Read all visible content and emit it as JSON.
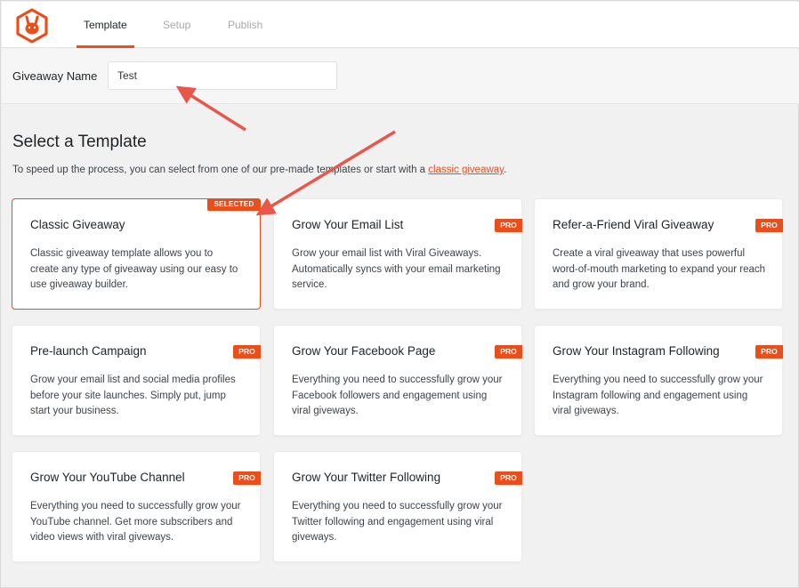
{
  "brand": {
    "accent": "#e94e1b",
    "logo": "rabbit-logo-icon"
  },
  "tabs": [
    {
      "label": "Template",
      "active": true
    },
    {
      "label": "Setup",
      "active": false
    },
    {
      "label": "Publish",
      "active": false
    }
  ],
  "giveaway_name": {
    "label": "Giveaway Name",
    "value": "Test"
  },
  "section": {
    "title": "Select a Template",
    "subtitle_prefix": "To speed up the process, you can select from one of our pre-made templates or start with a",
    "subtitle_link": "classic giveaway",
    "subtitle_suffix": "."
  },
  "templates": [
    {
      "title": "Classic Giveaway",
      "desc": "Classic giveaway template allows you to create any type of giveaway using our easy to use giveaway builder.",
      "badge": "SELECTED"
    },
    {
      "title": "Grow Your Email List",
      "desc": "Grow your email list with Viral Giveaways. Automatically syncs with your email marketing service.",
      "badge": "PRO"
    },
    {
      "title": "Refer-a-Friend Viral Giveaway",
      "desc": "Create a viral giveaway that uses powerful word-of-mouth marketing to expand your reach and grow your brand.",
      "badge": "PRO"
    },
    {
      "title": "Pre-launch Campaign",
      "desc": "Grow your email list and social media profiles before your site launches. Simply put, jump start your business.",
      "badge": "PRO"
    },
    {
      "title": "Grow Your Facebook Page",
      "desc": "Everything you need to successfully grow your Facebook followers and engagement using viral giveways.",
      "badge": "PRO"
    },
    {
      "title": "Grow Your Instagram Following",
      "desc": "Everything you need to successfully grow your Instagram following and engagement using viral giveways.",
      "badge": "PRO"
    },
    {
      "title": "Grow Your YouTube Channel",
      "desc": "Everything you need to successfully grow your YouTube channel. Get more subscribers and video views with viral giveways.",
      "badge": "PRO"
    },
    {
      "title": "Grow Your Twitter Following",
      "desc": "Everything you need to successfully grow your Twitter following and engagement using viral giveways.",
      "badge": "PRO"
    }
  ]
}
